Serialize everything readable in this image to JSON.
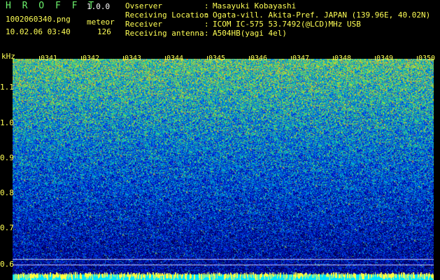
{
  "app": {
    "name": "H R O F F T",
    "version": "1.0.0"
  },
  "file": {
    "name": "1002060340.png",
    "datetime": "10.02.06 03:40"
  },
  "meteor": {
    "label": "meteor",
    "count": "126"
  },
  "station": [
    {
      "label": "Ovserver",
      "sep": ":",
      "value": "Masayuki Kobayashi"
    },
    {
      "label": "Receiving Location",
      "sep": ":",
      "value": "Ogata-vill. Akita-Pref. JAPAN (139.96E, 40.02N)"
    },
    {
      "label": "Receiver",
      "sep": ":",
      "value": "ICOM IC-575 53.7492(@LCD)MHz USB"
    },
    {
      "label": "Receiving antenna",
      "sep": ":",
      "value": "A504HB(yagi 4el)"
    }
  ],
  "axis": {
    "y_unit": "kHz",
    "y_ticks": [
      "1.1",
      "1.0",
      "0.9",
      "0.8",
      "0.7",
      "0.6"
    ],
    "x_ticks": [
      "0341",
      "0342",
      "0343",
      "0344",
      "0345",
      "0346",
      "0347",
      "0348",
      "0349",
      "0350"
    ]
  },
  "colors": {
    "text": "#ffff55",
    "app": "#6cf26c",
    "background": "#000000"
  }
}
